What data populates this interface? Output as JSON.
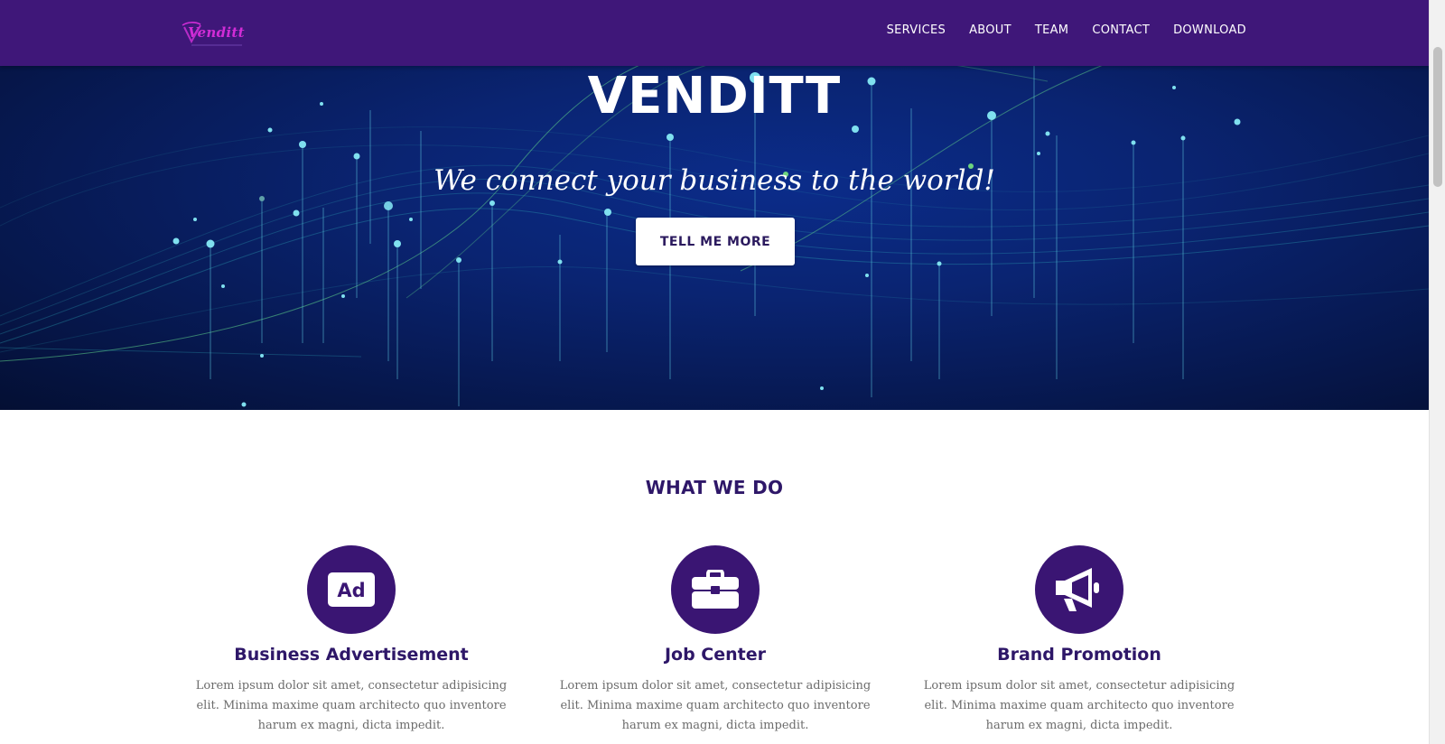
{
  "navbar": {
    "logo_text": "Venditt",
    "links": [
      "SERVICES",
      "ABOUT",
      "TEAM",
      "CONTACT",
      "DOWNLOAD"
    ]
  },
  "hero": {
    "title": "VENDITT",
    "subtitle": "We connect your business to the world!",
    "button_label": "TELL ME MORE"
  },
  "what_we_do": {
    "title": "WHAT WE DO",
    "services": [
      {
        "icon": "ad-icon",
        "name": "Business Advertisement",
        "description": "Lorem ipsum dolor sit amet, consectetur adipisicing elit. Minima maxime quam architecto quo inventore harum ex magni, dicta impedit."
      },
      {
        "icon": "briefcase-icon",
        "name": "Job Center",
        "description": "Lorem ipsum dolor sit amet, consectetur adipisicing elit. Minima maxime quam architecto quo inventore harum ex magni, dicta impedit."
      },
      {
        "icon": "megaphone-icon",
        "name": "Brand Promotion",
        "description": "Lorem ipsum dolor sit amet, consectetur adipisicing elit. Minima maxime quam architecto quo inventore harum ex magni, dicta impedit."
      }
    ]
  },
  "colors": {
    "navbar": "#3f1779",
    "accent": "#2e1768",
    "icon_circle": "#3a1573",
    "logo": "#d12cd6",
    "hero_bg": "#0a2472"
  }
}
